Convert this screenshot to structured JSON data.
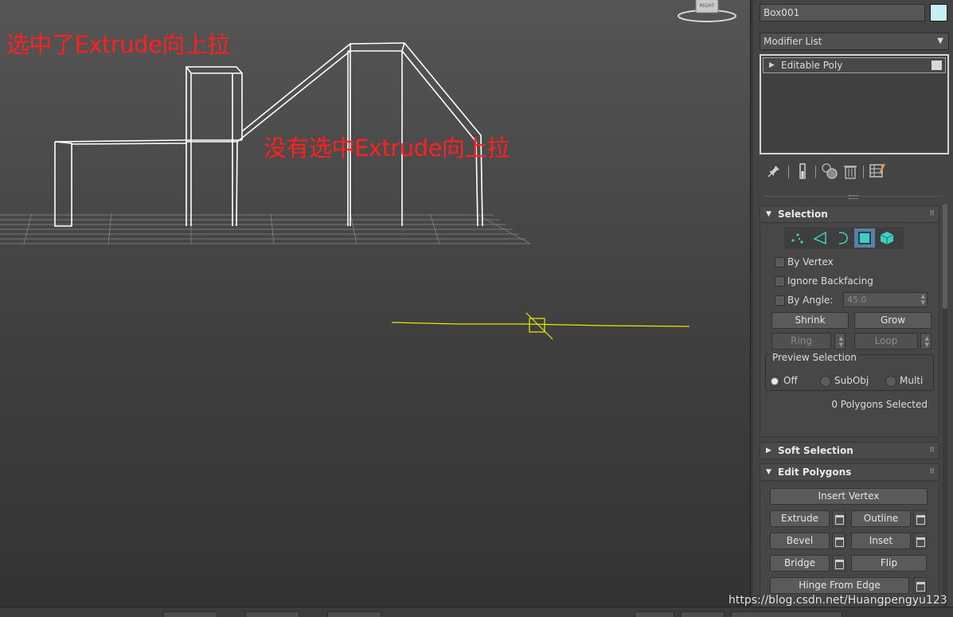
{
  "viewport": {
    "annotation_selected": "选中了Extrude向上拉",
    "annotation_unselected": "没有选中Extrude向上拉",
    "viewcube_label": "RIGHT"
  },
  "panel": {
    "object_name": "Box001",
    "object_color": "#c8eef6",
    "modifier_list_label": "Modifier List",
    "stack_items": [
      "Editable Poly"
    ],
    "stack_tools": [
      "pin-icon",
      "show-end-result-icon",
      "make-unique-icon",
      "remove-modifier-icon",
      "configure-modifier-sets-icon"
    ]
  },
  "selection": {
    "title": "Selection",
    "subobject_modes": [
      "vertex-icon",
      "edge-icon",
      "border-icon",
      "polygon-icon",
      "element-icon"
    ],
    "active_mode": "polygon-icon",
    "by_vertex": "By Vertex",
    "ignore_backfacing": "Ignore Backfacing",
    "by_angle": "By Angle:",
    "angle_value": "45.0",
    "shrink": "Shrink",
    "grow": "Grow",
    "ring": "Ring",
    "loop": "Loop",
    "preview_title": "Preview Selection",
    "preview_options": [
      "Off",
      "SubObj",
      "Multi"
    ],
    "preview_selected": "Off",
    "status": "0 Polygons Selected"
  },
  "soft_selection": {
    "title": "Soft Selection"
  },
  "edit_polygons": {
    "title": "Edit Polygons",
    "insert_vertex": "Insert Vertex",
    "extrude": "Extrude",
    "outline": "Outline",
    "bevel": "Bevel",
    "inset": "Inset",
    "bridge": "Bridge",
    "flip": "Flip",
    "hinge": "Hinge From Edge"
  },
  "watermark": "https://blog.csdn.net/Huangpengyu123",
  "colors": {
    "annotation": "#ff2020",
    "wireframe": "#ffffff",
    "gizmo": "#e8e800",
    "active_mode": "#5b7fa8"
  }
}
